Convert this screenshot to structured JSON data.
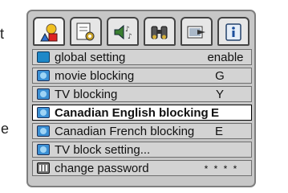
{
  "edge_text": {
    "left_top": "t",
    "left_mid": "e"
  },
  "tabs": [
    {
      "icon": "shapes-icon",
      "active": true
    },
    {
      "icon": "settings-sheet-icon",
      "active": false
    },
    {
      "icon": "speaker-sound-icon",
      "active": false
    },
    {
      "icon": "binoculars-icon",
      "active": false
    },
    {
      "icon": "video-input-icon",
      "active": false
    },
    {
      "icon": "info-icon",
      "active": false
    }
  ],
  "menu": {
    "rows": [
      {
        "label": "global setting",
        "value": "enable",
        "icon": "screen-icon"
      },
      {
        "label": "movie blocking",
        "value": "G",
        "icon": "tv-icon"
      },
      {
        "label": "TV blocking",
        "value": "Y",
        "icon": "tv-icon"
      },
      {
        "label": "Canadian English blocking",
        "value": "E",
        "icon": "tv-icon",
        "selected": true
      },
      {
        "label": "Canadian French blocking",
        "value": "E",
        "icon": "tv-icon"
      },
      {
        "label": "TV block setting...",
        "value": "",
        "icon": "tv-icon"
      },
      {
        "label": "change password",
        "value": "* * * *",
        "icon": "keypad-icon"
      }
    ]
  }
}
